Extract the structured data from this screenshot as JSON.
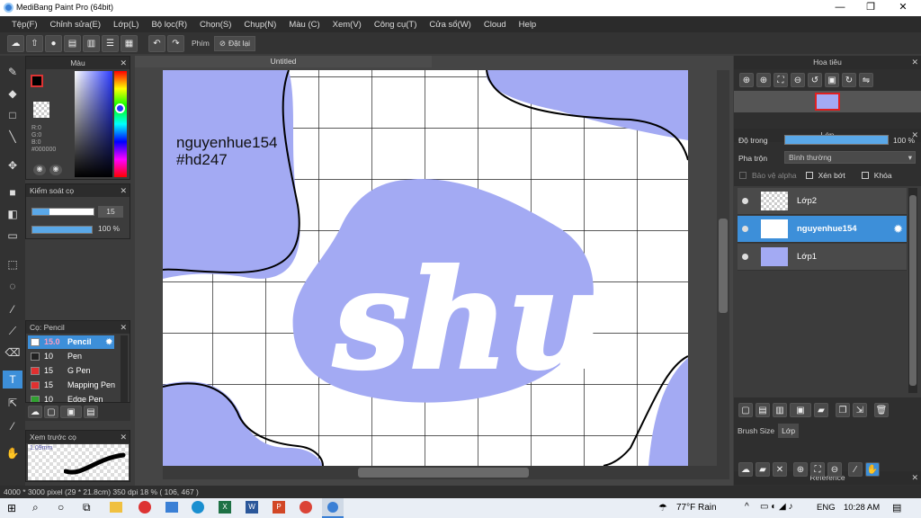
{
  "window": {
    "title": "MediBang Paint Pro (64bit)",
    "min": "—",
    "max": "❐",
    "close": "✕"
  },
  "menu": [
    "Tệp(F)",
    "Chỉnh sửa(E)",
    "Lớp(L)",
    "Bộ lọc(R)",
    "Chọn(S)",
    "Chụp(N)",
    "Màu (C)",
    "Xem(V)",
    "Công cụ(T)",
    "Cửa sổ(W)",
    "Cloud",
    "Help"
  ],
  "toolbar": {
    "shortcut_label": "Phím",
    "reset_label": "Đặt lại"
  },
  "color_panel": {
    "title": "Màu",
    "r": "R:0",
    "g": "G:0",
    "b": "B:0",
    "hex": "#000000"
  },
  "brush_control": {
    "title": "Kiểm soát cọ",
    "size": "15",
    "opacity": "100 %"
  },
  "brush_panel": {
    "title": "Cọ: Pencil",
    "items": [
      {
        "size": "15.0",
        "name": "Pencil",
        "color": "#ffffff"
      },
      {
        "size": "10",
        "name": "Pen",
        "color": "#222222"
      },
      {
        "size": "15",
        "name": "G Pen",
        "color": "#e03030"
      },
      {
        "size": "15",
        "name": "Mapping Pen",
        "color": "#e03030"
      },
      {
        "size": "10",
        "name": "Edge Pen",
        "color": "#30a030"
      }
    ]
  },
  "preview_panel": {
    "title": "Xem trước cọ",
    "size": "1.09mm"
  },
  "document": {
    "tab": "Untitled",
    "text1": "nguyenhue154",
    "text2": "#hd247",
    "logo": "shu"
  },
  "navigator": {
    "title": "Hoa tiêu"
  },
  "layer_panel": {
    "title": "Lớp",
    "opacity_label": "Độ trong",
    "opacity_value": "100 %",
    "blend_label": "Pha trộn",
    "blend_value": "Bình thường",
    "protect_alpha": "Bảo vệ alpha",
    "clipping": "Xén bớt",
    "lock": "Khóa",
    "layers": [
      "Lớp2",
      "nguyenhue154",
      "Lớp1"
    ]
  },
  "bottom_tabs": {
    "brush_size": "Brush Size",
    "layer": "Lớp"
  },
  "reference_panel": {
    "title": "Reference"
  },
  "status": {
    "text": "4000 * 3000 pixel   (29 * 21.8cm)   350 dpi   18 %   ( 106, 467 )"
  },
  "taskbar": {
    "weather": "77°F  Rain",
    "lang": "ENG",
    "time": "10:28 AM"
  },
  "colors": {
    "blob": "#a3aaf3",
    "accent": "#3d8fd9"
  }
}
